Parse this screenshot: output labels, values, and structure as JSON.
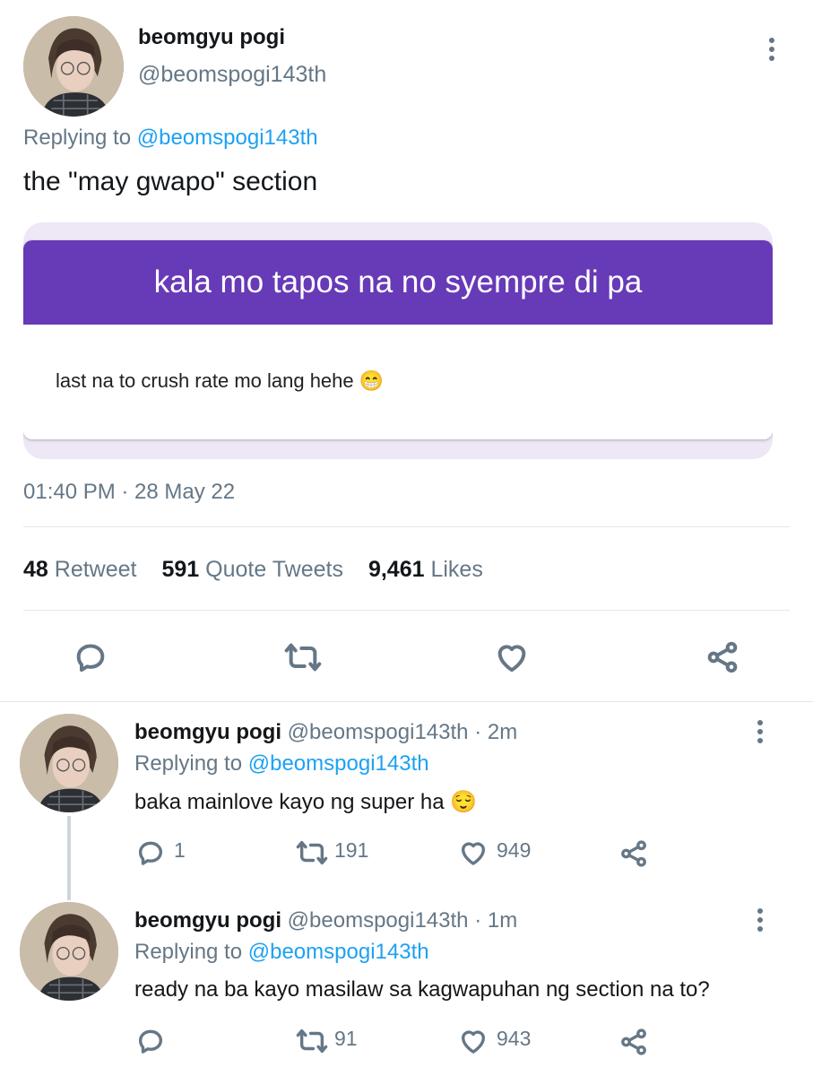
{
  "main_tweet": {
    "display_name": "beomgyu pogi",
    "handle": "@beomspogi143th",
    "replying_prefix": "Replying to",
    "replying_to": "@beomspogi143th",
    "text": "the \"may gwapo\" section",
    "form_card": {
      "header_title": "kala mo tapos na no syempre di pa",
      "body_text": "last na to crush rate mo lang hehe 😁",
      "header_color": "#673ab7"
    },
    "timestamp": "01:40 PM · 28 May 22",
    "stats": {
      "retweets": "48",
      "retweets_label": "Retweet",
      "quotes": "591",
      "quotes_label": "Quote Tweets",
      "likes": "9,461",
      "likes_label": "Likes"
    }
  },
  "replies": [
    {
      "display_name": "beomgyu pogi",
      "handle": "@beomspogi143th",
      "time": "· 2m",
      "replying_prefix": "Replying to",
      "replying_to": "@beomspogi143th",
      "text": "baka mainlove kayo ng super ha 😌",
      "reply_count": "1",
      "retweet_count": "191",
      "like_count": "949"
    },
    {
      "display_name": "beomgyu pogi",
      "handle": "@beomspogi143th",
      "time": "· 1m",
      "replying_prefix": "Replying to",
      "replying_to": "@beomspogi143th",
      "text": "ready na ba kayo masilaw sa kagwapuhan ng section na to?",
      "reply_count": "",
      "retweet_count": "91",
      "like_count": "943"
    }
  ],
  "colors": {
    "accent": "#1da1f2",
    "muted": "#657786",
    "form_purple": "#673ab7"
  },
  "icons": [
    "reply-icon",
    "retweet-icon",
    "like-icon",
    "share-icon",
    "more-icon"
  ]
}
